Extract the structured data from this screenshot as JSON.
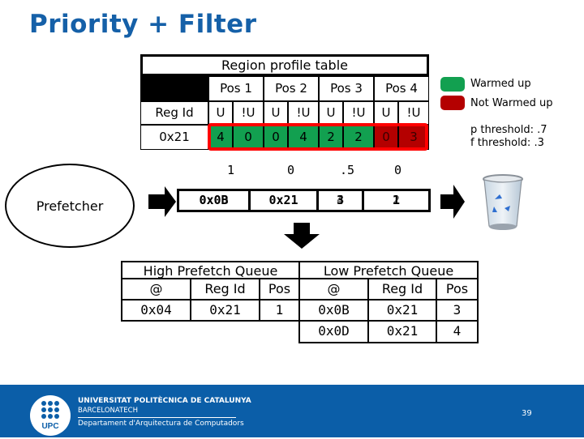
{
  "title": "Priority + Filter",
  "region_profile_table": {
    "title": "Region profile table",
    "positions": [
      "Pos 1",
      "Pos 2",
      "Pos 3",
      "Pos 4"
    ],
    "reg_id_label": "Reg Id",
    "sub_headers": [
      "U",
      "!U",
      "U",
      "!U",
      "U",
      "!U",
      "U",
      "!U"
    ],
    "rows": [
      {
        "reg_id": "0x21",
        "values": [
          "4",
          "0",
          "0",
          "4",
          "2",
          "2",
          "0",
          "3"
        ],
        "states": [
          "warm",
          "warm",
          "warm",
          "warm",
          "warm",
          "warm",
          "cold",
          "cold"
        ]
      }
    ]
  },
  "legend": {
    "items": [
      {
        "label": "Warmed up",
        "color": "#12a050"
      },
      {
        "label": "Not Warmed up",
        "color": "#b40000"
      }
    ],
    "p_threshold": "p threshold: .7",
    "f_threshold": "f threshold: .3"
  },
  "probabilities": [
    "1",
    "0",
    ".5",
    "0"
  ],
  "prefetcher_label": "Prefetcher",
  "pipeline": {
    "cells": [
      {
        "primary": "0x0B",
        "overlay": "0x0D"
      },
      {
        "primary": "0x21",
        "overlay": ""
      },
      {
        "primary": "3",
        "overlay": "4"
      },
      {
        "primary": "1",
        "overlay": "2"
      }
    ]
  },
  "high_queue": {
    "title": "High Prefetch Queue",
    "columns": [
      "@",
      "Reg Id",
      "Pos"
    ],
    "rows": [
      [
        "0x04",
        "0x21",
        "1"
      ]
    ]
  },
  "low_queue": {
    "title": "Low Prefetch Queue",
    "columns": [
      "@",
      "Reg Id",
      "Pos"
    ],
    "rows": [
      [
        "0x0B",
        "0x21",
        "3"
      ],
      [
        "0x0D",
        "0x21",
        "4"
      ]
    ]
  },
  "footer": {
    "logo_text": "UPC",
    "university": "UNIVERSITAT POLITÈCNICA DE CATALUNYA",
    "campus": "BARCELONATECH",
    "department": "Departament d'Arquitectura de Computadors",
    "page_number": "39"
  },
  "colors": {
    "title": "#1560a8",
    "warm": "#12a050",
    "cold": "#b40000",
    "footer_bg": "#0b5ea8",
    "highlight_frame": "#ff0000"
  }
}
